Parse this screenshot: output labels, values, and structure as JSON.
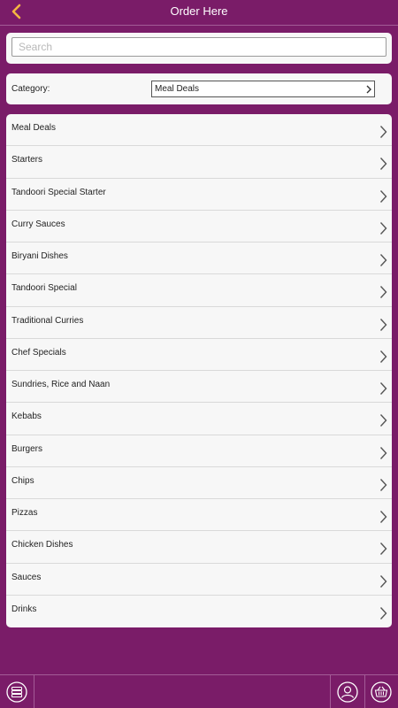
{
  "header": {
    "title": "Order Here"
  },
  "search": {
    "placeholder": "Search",
    "value": ""
  },
  "category": {
    "label": "Category:",
    "selected": "Meal Deals"
  },
  "menu": {
    "items": [
      {
        "label": "Meal Deals"
      },
      {
        "label": "Starters"
      },
      {
        "label": "Tandoori Special Starter"
      },
      {
        "label": "Curry Sauces"
      },
      {
        "label": "Biryani Dishes"
      },
      {
        "label": "Tandoori Special"
      },
      {
        "label": "Traditional Curries"
      },
      {
        "label": "Chef Specials"
      },
      {
        "label": "Sundries, Rice and Naan"
      },
      {
        "label": "Kebabs"
      },
      {
        "label": "Burgers"
      },
      {
        "label": "Chips"
      },
      {
        "label": "Pizzas"
      },
      {
        "label": "Chicken Dishes"
      },
      {
        "label": "Sauces"
      },
      {
        "label": "Drinks"
      }
    ]
  },
  "bottom_bar": {
    "icons": [
      "menu-list-icon",
      "user-icon",
      "basket-icon"
    ]
  },
  "colors": {
    "brand": "#7a1c68",
    "back_arrow": "#f5b642",
    "card": "#f7f7f7"
  }
}
